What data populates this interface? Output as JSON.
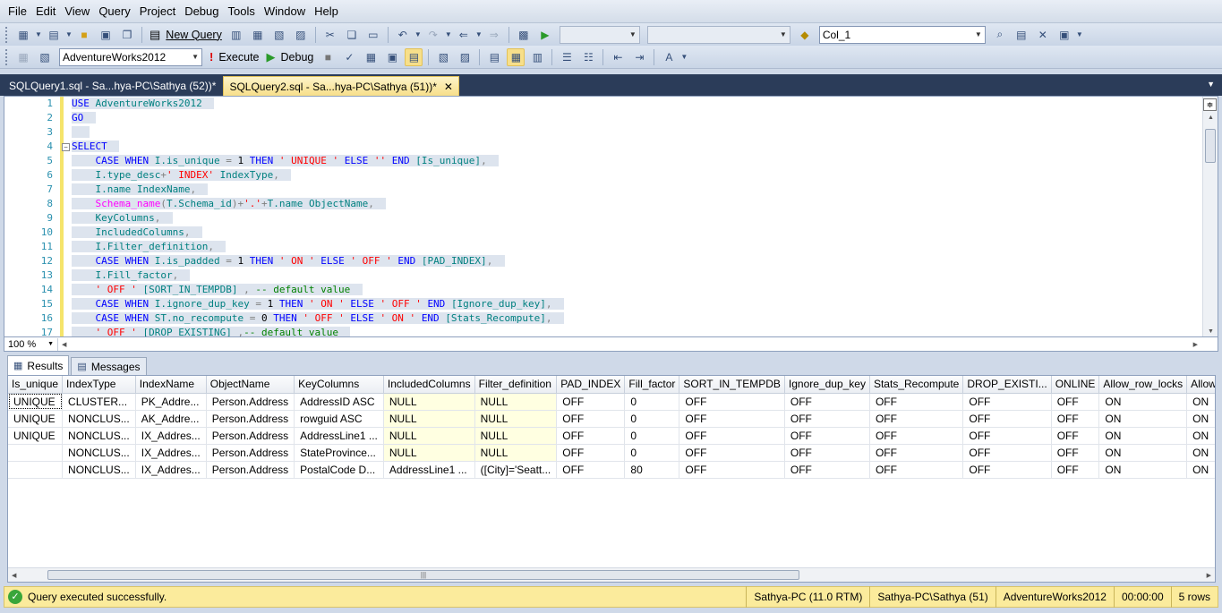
{
  "menu": [
    "File",
    "Edit",
    "View",
    "Query",
    "Project",
    "Debug",
    "Tools",
    "Window",
    "Help"
  ],
  "toolbar1": {
    "new_query_label": "New Query",
    "find_combo_value": "Col_1"
  },
  "toolbar2": {
    "database": "AdventureWorks2012",
    "execute_label": "Execute",
    "debug_label": "Debug"
  },
  "tabs": [
    {
      "label": "SQLQuery1.sql - Sa...hya-PC\\Sathya (52))*",
      "active": false
    },
    {
      "label": "SQLQuery2.sql - Sa...hya-PC\\Sathya (51))*",
      "active": true
    }
  ],
  "editor": {
    "line_numbers": [
      "1",
      "2",
      "3",
      "4",
      "5",
      "6",
      "7",
      "8",
      "9",
      "10",
      "11",
      "12",
      "13",
      "14",
      "15",
      "16",
      "17"
    ],
    "zoom": "100 %"
  },
  "results_tabs": {
    "results_label": "Results",
    "messages_label": "Messages"
  },
  "grid": {
    "columns": [
      "Is_unique",
      "IndexType",
      "IndexName",
      "ObjectName",
      "KeyColumns",
      "IncludedColumns",
      "Filter_definition",
      "PAD_INDEX",
      "Fill_factor",
      "SORT_IN_TEMPDB",
      "Ignore_dup_key",
      "Stats_Recompute",
      "DROP_EXISTI...",
      "ONLINE",
      "Allow_row_locks",
      "Allow_page_locks"
    ],
    "rows": [
      [
        "UNIQUE",
        "CLUSTER...",
        "PK_Addre...",
        "Person.Address",
        "AddressID ASC",
        "NULL",
        "NULL",
        "OFF",
        "0",
        "OFF",
        "OFF",
        "OFF",
        "OFF",
        "OFF",
        "ON",
        "ON"
      ],
      [
        "UNIQUE",
        "NONCLUS...",
        "AK_Addre...",
        "Person.Address",
        "rowguid ASC",
        "NULL",
        "NULL",
        "OFF",
        "0",
        "OFF",
        "OFF",
        "OFF",
        "OFF",
        "OFF",
        "ON",
        "ON"
      ],
      [
        "UNIQUE",
        "NONCLUS...",
        "IX_Addres...",
        "Person.Address",
        "AddressLine1 ...",
        "NULL",
        "NULL",
        "OFF",
        "0",
        "OFF",
        "OFF",
        "OFF",
        "OFF",
        "OFF",
        "ON",
        "ON"
      ],
      [
        "",
        "NONCLUS...",
        "IX_Addres...",
        "Person.Address",
        "StateProvince...",
        "NULL",
        "NULL",
        "OFF",
        "0",
        "OFF",
        "OFF",
        "OFF",
        "OFF",
        "OFF",
        "ON",
        "ON"
      ],
      [
        "",
        "NONCLUS...",
        "IX_Addres...",
        "Person.Address",
        "PostalCode D...",
        "AddressLine1 ...",
        "([City]='Seatt...",
        "OFF",
        "80",
        "OFF",
        "OFF",
        "OFF",
        "OFF",
        "OFF",
        "ON",
        "ON"
      ]
    ]
  },
  "status": {
    "message": "Query executed successfully.",
    "server": "Sathya-PC (11.0 RTM)",
    "user": "Sathya-PC\\Sathya (51)",
    "database": "AdventureWorks2012",
    "elapsed": "00:00:00",
    "rows": "5 rows"
  }
}
